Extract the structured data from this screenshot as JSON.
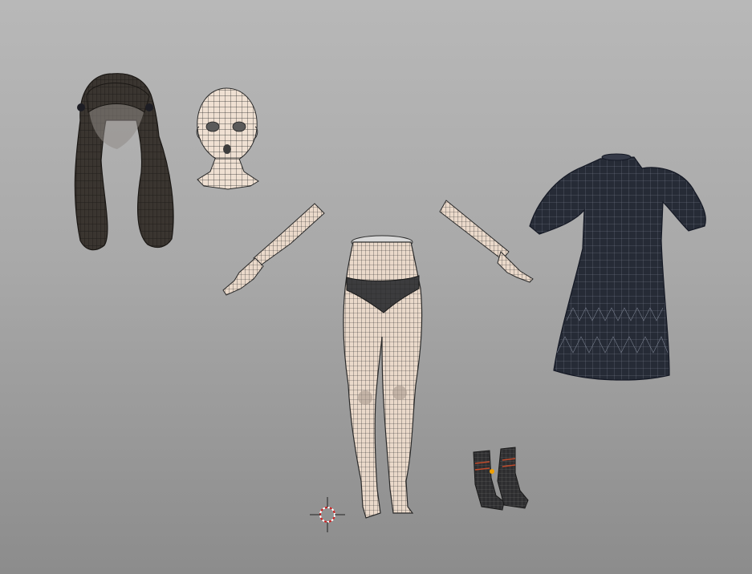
{
  "viewport": {
    "background_top": "#b8b8b8",
    "background_bottom": "#8c8c8c"
  },
  "assets": [
    {
      "id": "hair",
      "icon": "hair-mesh-icon",
      "color": "#3a3530"
    },
    {
      "id": "head",
      "icon": "head-mesh-icon",
      "color": "#efe0d2"
    },
    {
      "id": "arm-right",
      "icon": "arm-mesh-icon",
      "color": "#efe0d2"
    },
    {
      "id": "arm-left",
      "icon": "arm-mesh-icon",
      "color": "#efe0d2"
    },
    {
      "id": "legs",
      "icon": "legs-mesh-icon",
      "color": "#efe0d2"
    },
    {
      "id": "underwear",
      "icon": "underwear-mesh-icon",
      "color": "#3c3c3e"
    },
    {
      "id": "dress",
      "icon": "dress-mesh-icon",
      "color": "#262b36"
    },
    {
      "id": "shoes",
      "icon": "shoes-mesh-icon",
      "color": "#2e2e30"
    }
  ],
  "wire_color": "#2a2a2a",
  "cursor": {
    "icon": "3d-cursor-icon",
    "ring_color": "#d02020"
  },
  "origin_dot_color": "#f0a000"
}
